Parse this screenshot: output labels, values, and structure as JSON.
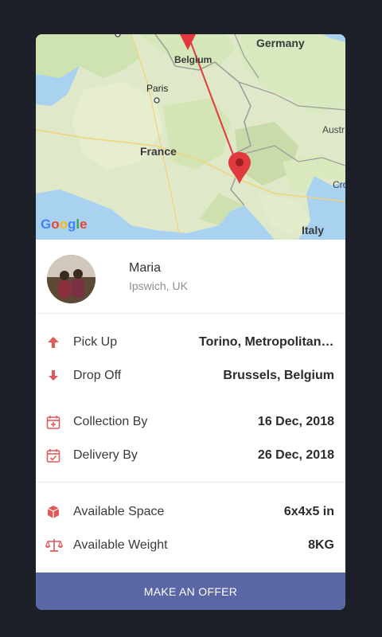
{
  "map": {
    "labels": {
      "germany": "Germany",
      "belgium": "Belgium",
      "paris": "Paris",
      "france": "France",
      "austria": "Austr",
      "croatia": "Cro",
      "italy": "Italy"
    },
    "google_logo": [
      "G",
      "o",
      "o",
      "g",
      "l",
      "e"
    ],
    "google_colors": [
      "#4285f4",
      "#ea4335",
      "#fbbc05",
      "#4285f4",
      "#34a853",
      "#ea4335"
    ],
    "route_color": "#e0393e"
  },
  "profile": {
    "name": "Maria",
    "location": "Ipswich, UK"
  },
  "route": {
    "pickup_label": "Pick Up",
    "pickup_value": "Torino, Metropolitan City of Turin, Italy",
    "dropoff_label": "Drop Off",
    "dropoff_value": "Brussels, Belgium"
  },
  "dates": {
    "collection_label": "Collection By",
    "collection_value": "16 Dec, 2018",
    "delivery_label": "Delivery By",
    "delivery_value": "26 Dec, 2018"
  },
  "capacity": {
    "space_label": "Available Space",
    "space_value": "6x4x5 in",
    "weight_label": "Available Weight",
    "weight_value": "8KG"
  },
  "actions": {
    "offer_label": "MAKE AN OFFER"
  },
  "colors": {
    "accent": "#e05a5a",
    "button": "#5b66a6",
    "background": "#1d2029"
  }
}
